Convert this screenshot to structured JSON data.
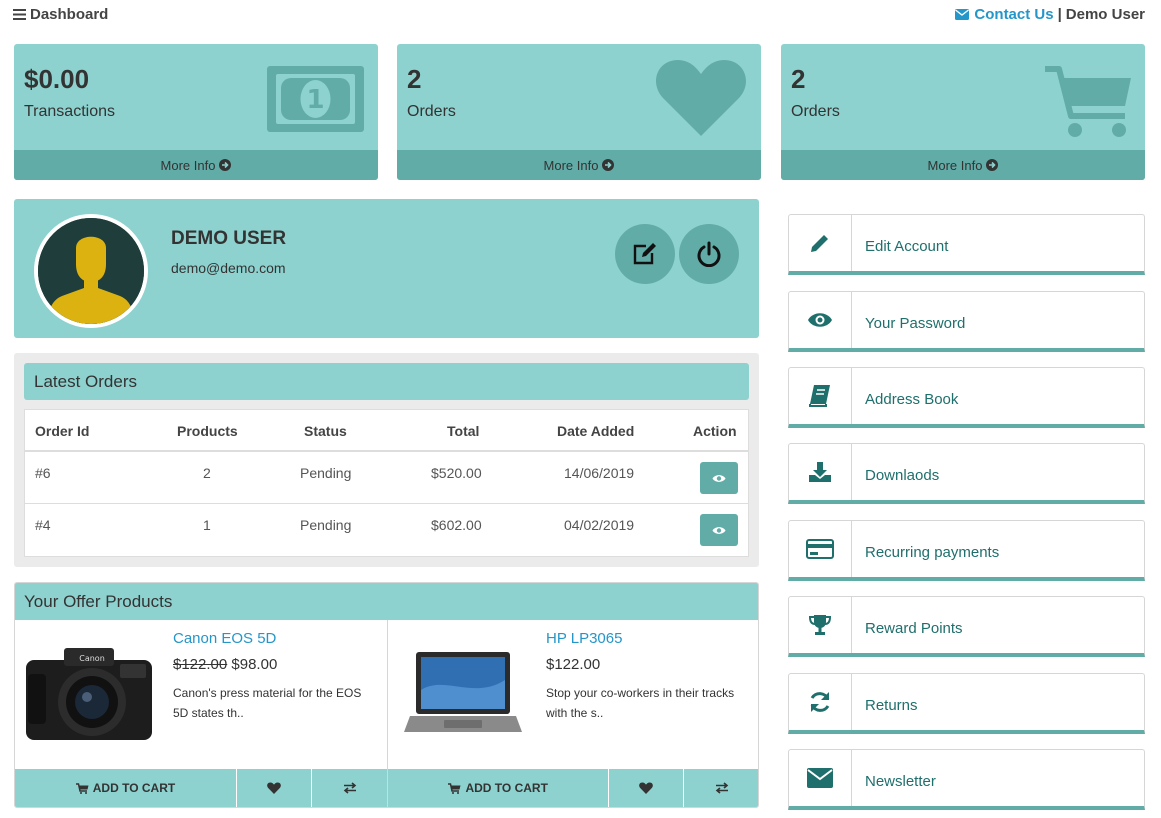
{
  "topbar": {
    "menu_icon": "bars-icon",
    "title": "Dashboard",
    "contact_icon": "envelope-icon",
    "contact_label": "Contact Us",
    "separator": "|",
    "user_label": "Demo User"
  },
  "stats": [
    {
      "value": "$0.00",
      "label": "Transactions",
      "icon": "money-bill-icon",
      "more": "More Info"
    },
    {
      "value": "2",
      "label": "Orders",
      "icon": "heart-icon",
      "more": "More Info"
    },
    {
      "value": "2",
      "label": "Orders",
      "icon": "cart-icon",
      "more": "More Info"
    }
  ],
  "profile": {
    "name": "DEMO USER",
    "email": "demo@demo.com",
    "edit_icon": "edit-icon",
    "logout_icon": "power-icon"
  },
  "latest_orders": {
    "title": "Latest Orders",
    "columns": [
      "Order Id",
      "Products",
      "Status",
      "Total",
      "Date Added",
      "Action"
    ],
    "rows": [
      {
        "id": "#6",
        "products": "2",
        "status": "Pending",
        "total": "$520.00",
        "date": "14/06/2019"
      },
      {
        "id": "#4",
        "products": "1",
        "status": "Pending",
        "total": "$602.00",
        "date": "04/02/2019"
      }
    ]
  },
  "offers": {
    "title": "Your Offer Products",
    "products": [
      {
        "name": "Canon EOS 5D",
        "old_price": "$122.00",
        "price": "$98.00",
        "desc": "Canon's press material for the EOS 5D states th..",
        "cart_label": "ADD TO CART"
      },
      {
        "name": "HP LP3065",
        "old_price": "",
        "price": "$122.00",
        "desc": "Stop your co-workers in their tracks with the s..",
        "cart_label": "ADD TO CART"
      }
    ]
  },
  "menu": [
    {
      "label": "Edit Account",
      "icon": "pencil-icon"
    },
    {
      "label": "Your Password",
      "icon": "eye-icon"
    },
    {
      "label": "Address Book",
      "icon": "book-icon"
    },
    {
      "label": "Downlaods",
      "icon": "download-icon"
    },
    {
      "label": "Recurring payments",
      "icon": "credit-card-icon"
    },
    {
      "label": "Reward Points",
      "icon": "trophy-icon"
    },
    {
      "label": "Returns",
      "icon": "refresh-icon"
    },
    {
      "label": "Newsletter",
      "icon": "envelope-icon"
    }
  ],
  "colors": {
    "accent": "#8dd2cf",
    "accent_dark": "#62aca8",
    "link": "#2596c9",
    "menu_text": "#1f6f6c"
  }
}
